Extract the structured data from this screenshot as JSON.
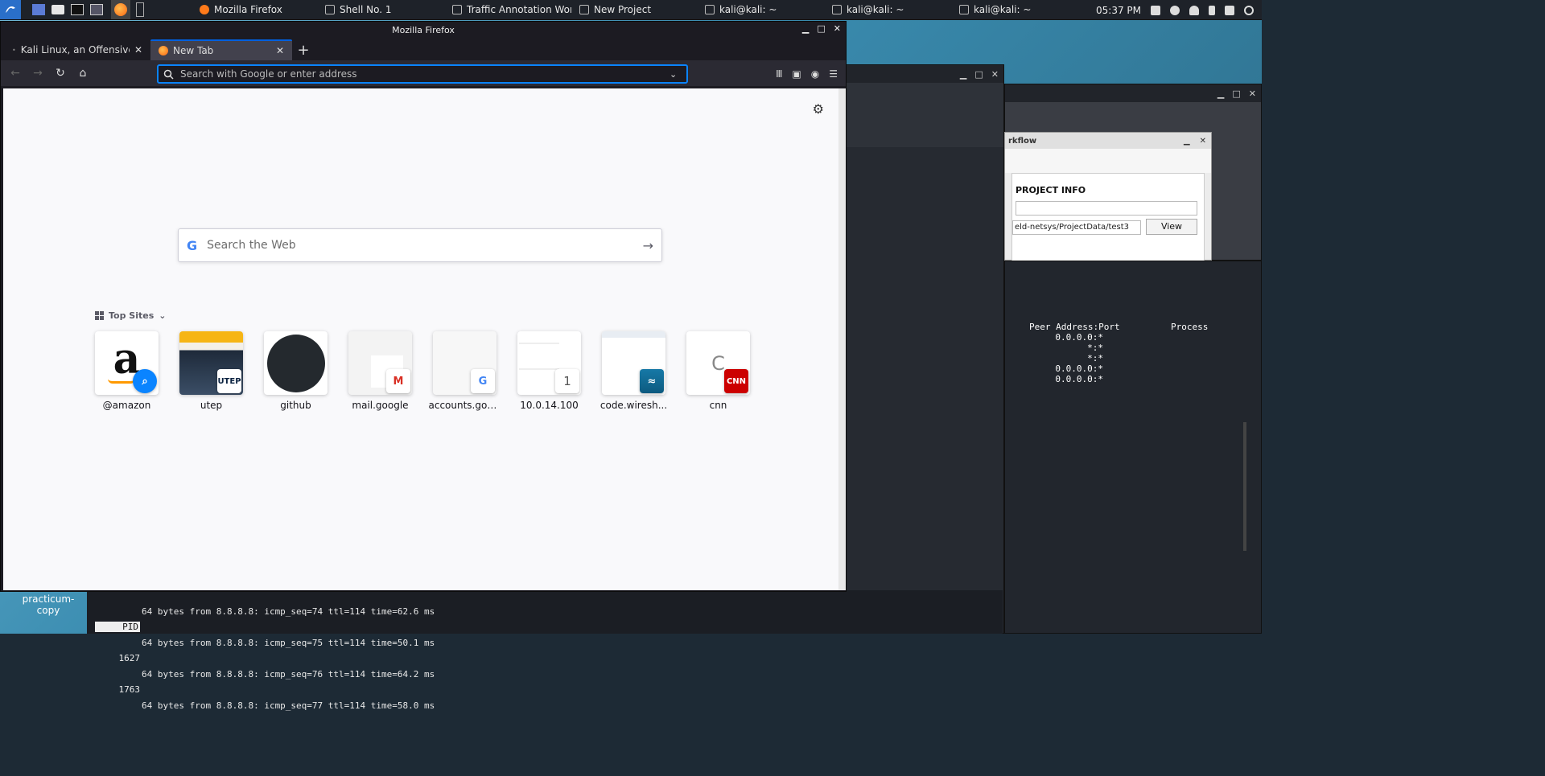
{
  "taskbar": {
    "tasks": [
      {
        "label": "Mozilla Firefox"
      },
      {
        "label": "Shell No. 1"
      },
      {
        "label": "Traffic Annotation Wor..."
      },
      {
        "label": "New Project"
      },
      {
        "label": "kali@kali: ~"
      },
      {
        "label": "kali@kali: ~"
      },
      {
        "label": "kali@kali: ~"
      }
    ],
    "clock": "05:37 PM"
  },
  "firefox": {
    "window_title": "Mozilla Firefox",
    "tabs": [
      {
        "label": "Kali Linux, an Offensive S"
      },
      {
        "label": "New Tab"
      }
    ],
    "urlbar": {
      "placeholder": "Search with Google or enter address",
      "value": ""
    },
    "newtab": {
      "search_placeholder": "Search the Web",
      "top_sites_label": "Top Sites",
      "top_sites": [
        {
          "label": "@amazon",
          "icon": "amazon-icon"
        },
        {
          "label": "utep",
          "icon": "utep-icon"
        },
        {
          "label": "github",
          "icon": "github-icon"
        },
        {
          "label": "mail.google",
          "icon": "gmail-icon"
        },
        {
          "label": "accounts.goo...",
          "icon": "google-icon"
        },
        {
          "label": "10.0.14.100",
          "icon": "letter-1-icon",
          "badge": "1"
        },
        {
          "label": "code.wiresh...",
          "icon": "wireshark-icon"
        },
        {
          "label": "cnn",
          "icon": "cnn-icon",
          "badge": "CNN",
          "fallback": "C"
        }
      ]
    }
  },
  "background": {
    "project_info": {
      "heading": "PROJECT INFO",
      "path_value": "eld-netsys/ProjectData/test3",
      "view_label": "View",
      "title_fragment": "rkflow"
    },
    "netstat": {
      "col_peer": "Peer Address:Port",
      "col_process": "Process",
      "rows": [
        "0.0.0.0:*",
        "*:*",
        "*:*",
        "0.0.0.0:*",
        "0.0.0.0:*"
      ]
    },
    "terminal": {
      "pid_header": "PID",
      "pids": [
        "1627",
        "1763"
      ],
      "lines": [
        "64 bytes from 8.8.8.8: icmp_seq=74 ttl=114 time=62.6 ms",
        "64 bytes from 8.8.8.8: icmp_seq=75 ttl=114 time=50.1 ms",
        "64 bytes from 8.8.8.8: icmp_seq=76 ttl=114 time=64.2 ms",
        "64 bytes from 8.8.8.8: icmp_seq=77 ttl=114 time=58.0 ms"
      ]
    },
    "desktop_icon_label": "practicum-copy"
  }
}
